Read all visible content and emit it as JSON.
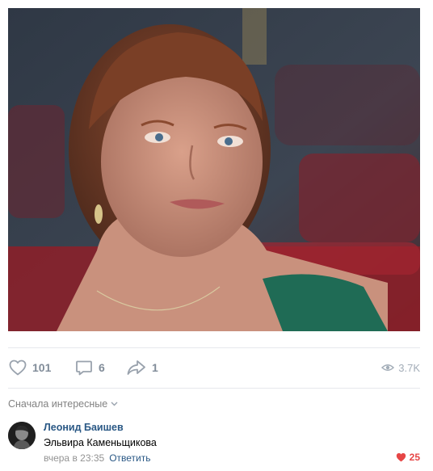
{
  "post": {
    "photo_alt_icon": "photo",
    "actions": {
      "likes": "101",
      "comments": "6",
      "shares": "1",
      "views": "3.7K"
    }
  },
  "comments": {
    "sort_label": "Сначала интересные",
    "items": [
      {
        "author": "Леонид Баишев",
        "text": "Эльвира Каменьщикова",
        "date": "вчера в 23:35",
        "reply_label": "Ответить",
        "likes": "25"
      }
    ]
  },
  "colors": {
    "link": "#2a5885",
    "muted": "#828282",
    "liked": "#e64646",
    "divider": "#e7e8ec"
  }
}
